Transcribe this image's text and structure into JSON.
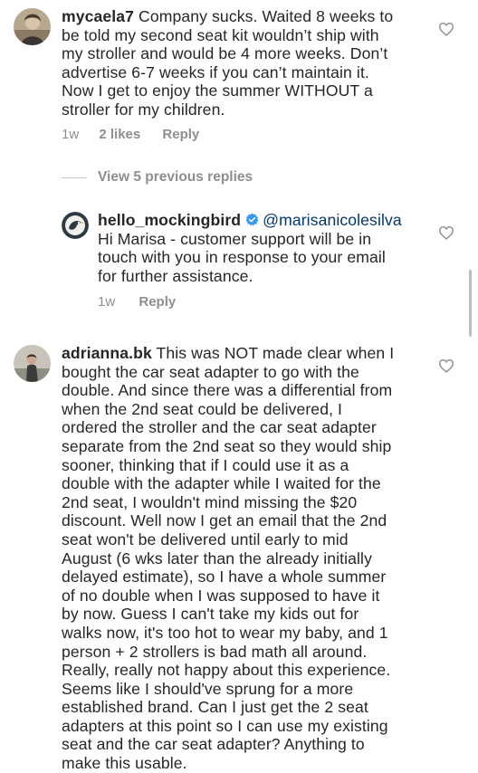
{
  "comments": [
    {
      "username": "mycaela7",
      "lines": [
        "Company sucks. Waited 8 weeks to",
        "be told my second seat kit wouldn’t ship with",
        "my stroller and would be 4 more weeks. Don’t",
        "advertise 6-7 weeks if you can’t maintain it.",
        "Now I get to enjoy the summer WITHOUT a",
        "stroller for my children."
      ],
      "time": "1w",
      "likes": "2 likes",
      "reply_label": "Reply"
    },
    {
      "username": "adrianna.bk",
      "lines": [
        "This was NOT made clear when I",
        "bought the car seat adapter to go with the",
        "double. And since there was a differential from",
        "when the 2nd seat could be delivered, I",
        "ordered the stroller and the car seat adapter",
        "separate from the 2nd seat so they would ship",
        "sooner, thinking that if I could use it as a",
        "double with the adapter while I waited for the",
        "2nd seat, I wouldn't mind missing the $20",
        "discount. Well now I get an email that the 2nd",
        "seat won't be delivered until early to mid",
        "August (6 wks later than the already initially",
        "delayed estimate), so I have a whole summer",
        "of no double when I was supposed to have it",
        "by now. Guess I can't take my kids out for",
        "walks now, it's too hot to wear my baby, and 1",
        "person + 2 strollers is bad math all around.",
        "Really, really not happy about this experience.",
        "Seems like I should've sprung for a more",
        "established brand. Can I just get the 2 seat",
        "adapters at this point so I can use my existing",
        "seat and the car seat adapter? Anything to",
        "make this usable."
      ]
    }
  ],
  "view_replies": "View 5 previous replies",
  "reply": {
    "username": "hello_mockingbird",
    "mention": "@marisanicolesilva",
    "lines": [
      "Hi Marisa - customer support will be in",
      "touch with you in response to your email",
      "for further assistance."
    ],
    "time": "1w",
    "reply_label": "Reply"
  },
  "colors": {
    "text": "#262626",
    "secondary": "#8e8e8e",
    "mention": "#00376b",
    "verified": "#3897f0"
  },
  "icons": {
    "like": "heart-outline-icon",
    "verified": "verified-badge-icon"
  }
}
